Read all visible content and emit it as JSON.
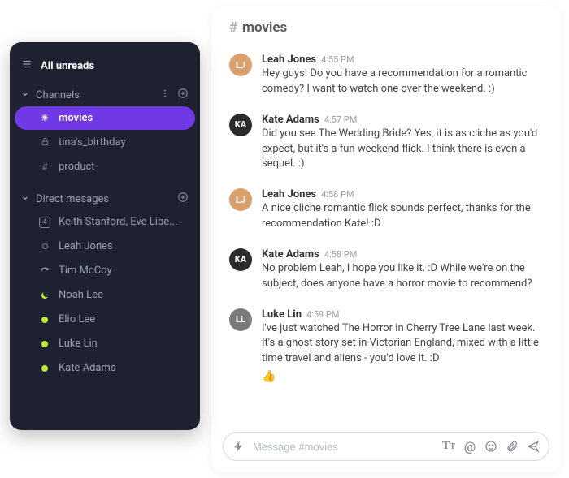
{
  "sidebar": {
    "all_unreads_label": "All unreads",
    "channels_label": "Channels",
    "direct_messages_label": "Direct mesages",
    "channels": [
      {
        "icon": "hash-bold",
        "label": "movies",
        "active": true
      },
      {
        "icon": "lock",
        "label": "tina's_birthday",
        "active": false
      },
      {
        "icon": "hash",
        "label": "product",
        "active": false
      }
    ],
    "dms": [
      {
        "icon": "count",
        "count": "4",
        "label": "Keith Stanford, Eve Libe..."
      },
      {
        "icon": "away",
        "label": "Leah Jones"
      },
      {
        "icon": "refresh",
        "label": "Tim McCoy"
      },
      {
        "icon": "crescent",
        "label": "Noah Lee"
      },
      {
        "icon": "online",
        "label": "Elio Lee"
      },
      {
        "icon": "online",
        "label": "Luke Lin"
      },
      {
        "icon": "online",
        "label": "Kate Adams"
      }
    ]
  },
  "chat": {
    "channel_name": "movies",
    "composer_placeholder": "Message #movies",
    "messages": [
      {
        "author": "Leah Jones",
        "time": "4:55 PM",
        "avatar_bg": "#d9a06b",
        "text": "Hey guys! Do you have a recommendation for a romantic comedy? I want to watch one over the weekend. :)"
      },
      {
        "author": "Kate Adams",
        "time": "4:57 PM",
        "avatar_bg": "#2b2b2b",
        "text": "Did you see The Wedding Bride? Yes, it is as cliche as you'd expect, but it's a fun weekend flick. I think there is even a sequel. :)"
      },
      {
        "author": "Leah Jones",
        "time": "4:58 PM",
        "avatar_bg": "#d9a06b",
        "text": "A nice cliche romantic flick sounds perfect, thanks for the recommendation Kate! :D"
      },
      {
        "author": "Kate Adams",
        "time": "4:58 PM",
        "avatar_bg": "#2b2b2b",
        "text": "No problem Leah, I hope you like it. :D While we're on the subject, does anyone have a horror movie to recommend?"
      },
      {
        "author": "Luke Lin",
        "time": "4:59 PM",
        "avatar_bg": "#7a7a7a",
        "text": "I've just watched The Horror in Cherry Tree Lane last week. It's a ghost story set in Victorian England, mixed with a little time travel and aliens - you'd love it. :D",
        "reaction": "👍"
      }
    ]
  }
}
